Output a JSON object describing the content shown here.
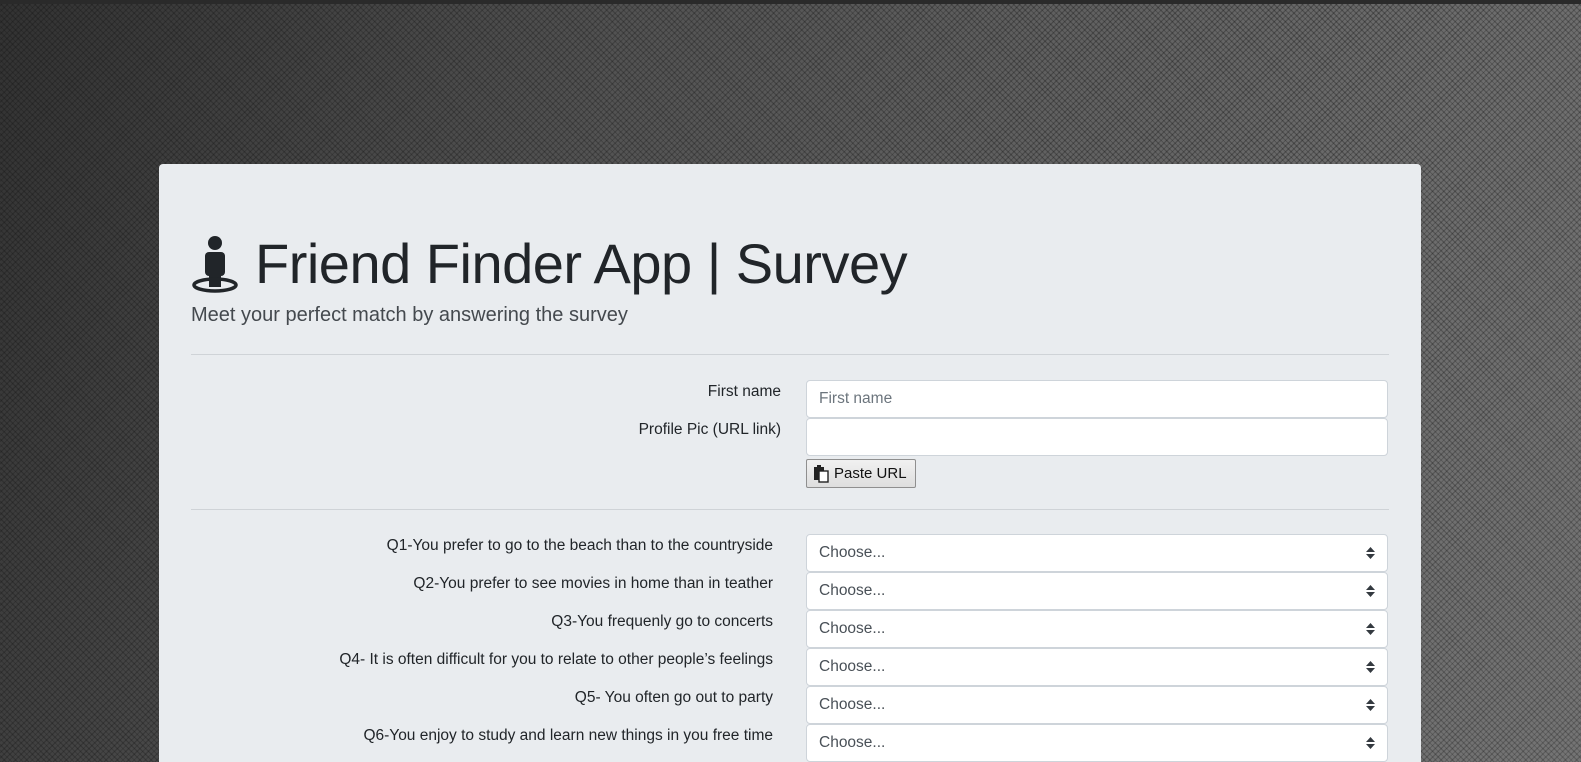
{
  "header": {
    "title": "Friend Finder App | Survey",
    "subtitle": "Meet your perfect match by answering the survey",
    "icon": "person-standing-icon"
  },
  "profile": {
    "first_name_label": "First name",
    "first_name_placeholder": "First name",
    "first_name_value": "",
    "pic_label": "Profile Pic (URL link)",
    "pic_value": "",
    "paste_button_label": "Paste URL",
    "paste_icon": "clipboard-paste-icon"
  },
  "questions": [
    {
      "label": "Q1-You prefer to go to the beach than to the countryside",
      "selected": "Choose..."
    },
    {
      "label": "Q2-You prefer to see movies in home than in teather",
      "selected": "Choose..."
    },
    {
      "label": "Q3-You frequenly go to concerts",
      "selected": "Choose..."
    },
    {
      "label": "Q4- It is often difficult for you to relate to other people’s feelings",
      "selected": "Choose..."
    },
    {
      "label": "Q5- You often go out to party",
      "selected": "Choose..."
    },
    {
      "label": "Q6-You enjoy to study and learn new things in you free time",
      "selected": "Choose..."
    }
  ],
  "colors": {
    "panel_background": "#e9ecef",
    "text": "#212529",
    "border": "#ced4da"
  }
}
